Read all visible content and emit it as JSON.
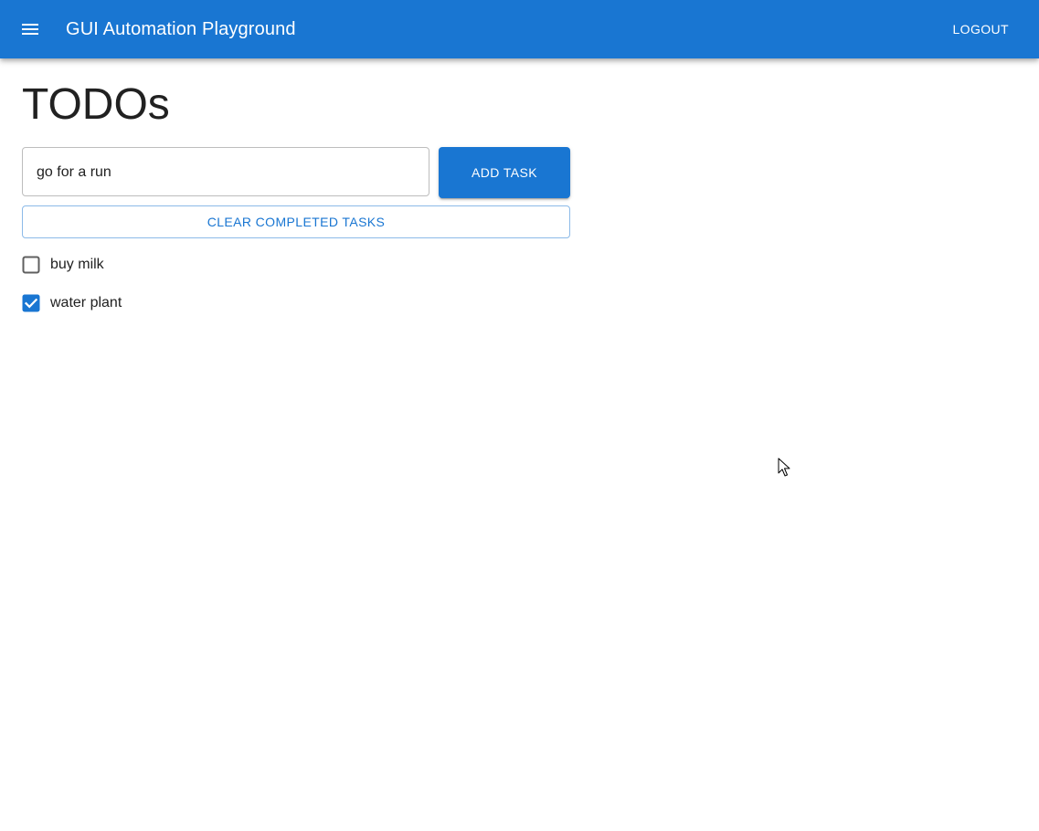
{
  "appbar": {
    "title": "GUI Automation Playground",
    "logout_label": "LOGOUT",
    "menu_icon": "hamburger-menu-icon",
    "background_color": "#1976d2"
  },
  "main": {
    "page_title": "TODOs",
    "task_input": {
      "value": "go for a run",
      "placeholder": ""
    },
    "add_task_label": "ADD TASK",
    "clear_completed_label": "CLEAR COMPLETED TASKS",
    "tasks": [
      {
        "label": "buy milk",
        "completed": false
      },
      {
        "label": "water plant",
        "completed": true
      }
    ]
  },
  "colors": {
    "primary": "#1976d2",
    "text": "#212121",
    "unchecked_box": "#5f5f5f"
  }
}
